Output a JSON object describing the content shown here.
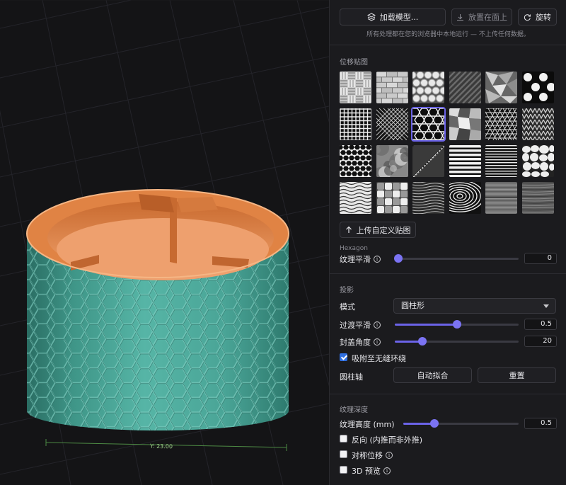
{
  "viewport": {
    "axis_label": "Y: 23.00",
    "colors": {
      "outer": "#4aa597",
      "inner": "#e08344",
      "background": "#141416"
    }
  },
  "toolbar": {
    "load_model_label": "加载模型...",
    "place_flat_label": "放置在面上",
    "rotate_label": "旋转",
    "privacy_note": "所有处理都在您的浏览器中本地运行 — 不上传任何数据。"
  },
  "displacement": {
    "section_title": "位移贴图",
    "textures": [
      "basket",
      "brick",
      "bubble",
      "carbon-fiber",
      "crystal",
      "dots",
      "grid",
      "diamond",
      "hexagon",
      "voronoi",
      "triangles",
      "knit",
      "hex-mesh",
      "noise",
      "speckle",
      "stripes",
      "thin-stripes",
      "stones",
      "wavy",
      "weave",
      "wood-grain",
      "wood-rings",
      "wood-plank",
      "wood-dark"
    ],
    "selected_texture": "hexagon",
    "upload_label": "上传自定义贴图",
    "selected_name": "Hexagon",
    "smoothing_label": "纹理平滑",
    "smoothing_value": 0,
    "smoothing_fraction": 0.0
  },
  "projection": {
    "section_title": "投影",
    "mode_label": "模式",
    "mode_value": "圆柱形",
    "transition_label": "过渡平滑",
    "transition_value": 0.5,
    "transition_fraction": 0.5,
    "cap_angle_label": "封盖角度",
    "cap_angle_value": 20,
    "cap_angle_fraction": 0.22,
    "seam_snap_label": "吸附至无缝环绕",
    "seam_snap_checked": true,
    "axis_label": "圆柱轴",
    "auto_fit_label": "自动拟合",
    "reset_label": "重置"
  },
  "depth": {
    "section_title": "纹理深度",
    "height_label": "纹理高度 (mm)",
    "height_value": 0.5,
    "height_fraction": 0.27,
    "invert_label": "反向 (内推而非外推)",
    "symmetric_label": "对称位移",
    "preview_label": "3D 预览"
  }
}
